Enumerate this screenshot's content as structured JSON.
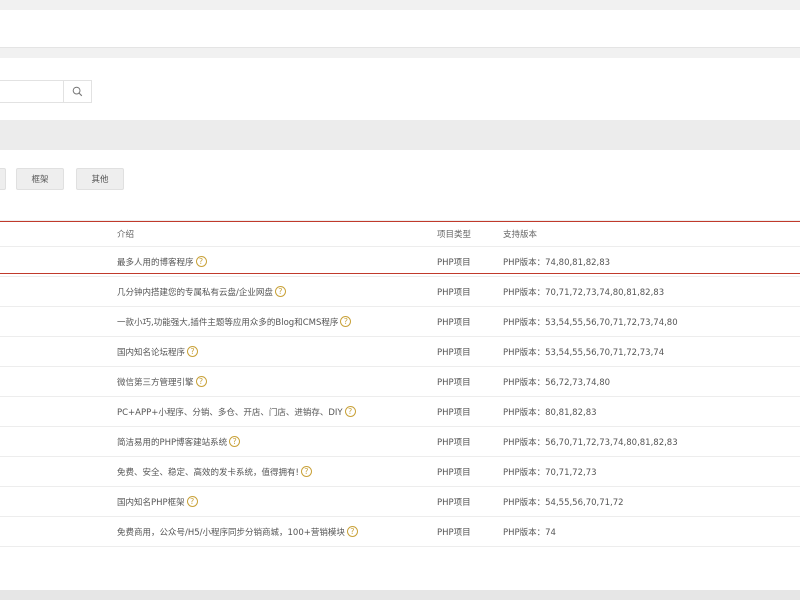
{
  "search": {
    "value": "",
    "placeholder": "",
    "button_icon": "search-icon"
  },
  "filters": [
    {
      "label": ""
    },
    {
      "label": "框架"
    },
    {
      "label": "其他"
    }
  ],
  "table": {
    "headers": {
      "intro": "介绍",
      "type": "项目类型",
      "version": "支持版本"
    },
    "rows": [
      {
        "intro": "最多人用的博客程序",
        "type": "PHP项目",
        "version": "PHP版本：74,80,81,82,83"
      },
      {
        "intro": "几分钟内搭建您的专属私有云盘/企业网盘",
        "type": "PHP项目",
        "version": "PHP版本：70,71,72,73,74,80,81,82,83"
      },
      {
        "intro": "一款小巧,功能强大,插件主题等应用众多的Blog和CMS程序",
        "type": "PHP项目",
        "version": "PHP版本：53,54,55,56,70,71,72,73,74,80"
      },
      {
        "intro": "国内知名论坛程序",
        "type": "PHP项目",
        "version": "PHP版本：53,54,55,56,70,71,72,73,74"
      },
      {
        "intro": "微信第三方管理引擎",
        "type": "PHP项目",
        "version": "PHP版本：56,72,73,74,80"
      },
      {
        "intro": "PC+APP+小程序、分销、多仓、开店、门店、进销存、DIY",
        "type": "PHP项目",
        "version": "PHP版本：80,81,82,83"
      },
      {
        "intro": "简洁易用的PHP博客建站系统",
        "type": "PHP项目",
        "version": "PHP版本：56,70,71,72,73,74,80,81,82,83"
      },
      {
        "intro": "免费、安全、稳定、高效的发卡系统，值得拥有!",
        "type": "PHP项目",
        "version": "PHP版本：70,71,72,73"
      },
      {
        "intro": "国内知名PHP框架",
        "type": "PHP项目",
        "version": "PHP版本：54,55,56,70,71,72"
      },
      {
        "intro": "免费商用，公众号/H5/小程序同步分销商城，100+营销模块",
        "type": "PHP项目",
        "version": "PHP版本：74"
      }
    ]
  },
  "colors": {
    "highlight": "#c0392b",
    "help_icon": "#c9a23a"
  }
}
